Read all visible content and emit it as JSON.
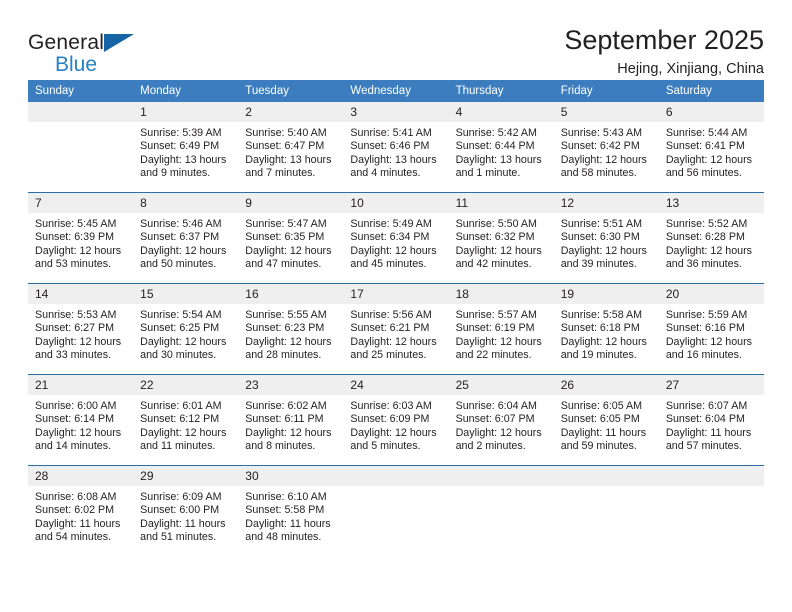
{
  "brand": {
    "name_top": "General",
    "name_bottom": "Blue",
    "accent_color": "#2581c4",
    "triangle_color": "#1565a6"
  },
  "header": {
    "title": "September 2025",
    "subtitle": "Hejing, Xinjiang, China"
  },
  "calendar": {
    "header_bg": "#3b7dbf",
    "header_text_color": "#ffffff",
    "row_divider_color": "#2e6da4",
    "daynum_bg": "#efeff0",
    "weekday_headers": [
      "Sunday",
      "Monday",
      "Tuesday",
      "Wednesday",
      "Thursday",
      "Friday",
      "Saturday"
    ],
    "weeks": [
      [
        {
          "day": "",
          "sunrise": "",
          "sunset": "",
          "daylight_line1": "",
          "daylight_line2": "",
          "empty": true
        },
        {
          "day": "1",
          "sunrise": "Sunrise: 5:39 AM",
          "sunset": "Sunset: 6:49 PM",
          "daylight_line1": "Daylight: 13 hours",
          "daylight_line2": "and 9 minutes."
        },
        {
          "day": "2",
          "sunrise": "Sunrise: 5:40 AM",
          "sunset": "Sunset: 6:47 PM",
          "daylight_line1": "Daylight: 13 hours",
          "daylight_line2": "and 7 minutes."
        },
        {
          "day": "3",
          "sunrise": "Sunrise: 5:41 AM",
          "sunset": "Sunset: 6:46 PM",
          "daylight_line1": "Daylight: 13 hours",
          "daylight_line2": "and 4 minutes."
        },
        {
          "day": "4",
          "sunrise": "Sunrise: 5:42 AM",
          "sunset": "Sunset: 6:44 PM",
          "daylight_line1": "Daylight: 13 hours",
          "daylight_line2": "and 1 minute."
        },
        {
          "day": "5",
          "sunrise": "Sunrise: 5:43 AM",
          "sunset": "Sunset: 6:42 PM",
          "daylight_line1": "Daylight: 12 hours",
          "daylight_line2": "and 58 minutes."
        },
        {
          "day": "6",
          "sunrise": "Sunrise: 5:44 AM",
          "sunset": "Sunset: 6:41 PM",
          "daylight_line1": "Daylight: 12 hours",
          "daylight_line2": "and 56 minutes."
        }
      ],
      [
        {
          "day": "7",
          "sunrise": "Sunrise: 5:45 AM",
          "sunset": "Sunset: 6:39 PM",
          "daylight_line1": "Daylight: 12 hours",
          "daylight_line2": "and 53 minutes."
        },
        {
          "day": "8",
          "sunrise": "Sunrise: 5:46 AM",
          "sunset": "Sunset: 6:37 PM",
          "daylight_line1": "Daylight: 12 hours",
          "daylight_line2": "and 50 minutes."
        },
        {
          "day": "9",
          "sunrise": "Sunrise: 5:47 AM",
          "sunset": "Sunset: 6:35 PM",
          "daylight_line1": "Daylight: 12 hours",
          "daylight_line2": "and 47 minutes."
        },
        {
          "day": "10",
          "sunrise": "Sunrise: 5:49 AM",
          "sunset": "Sunset: 6:34 PM",
          "daylight_line1": "Daylight: 12 hours",
          "daylight_line2": "and 45 minutes."
        },
        {
          "day": "11",
          "sunrise": "Sunrise: 5:50 AM",
          "sunset": "Sunset: 6:32 PM",
          "daylight_line1": "Daylight: 12 hours",
          "daylight_line2": "and 42 minutes."
        },
        {
          "day": "12",
          "sunrise": "Sunrise: 5:51 AM",
          "sunset": "Sunset: 6:30 PM",
          "daylight_line1": "Daylight: 12 hours",
          "daylight_line2": "and 39 minutes."
        },
        {
          "day": "13",
          "sunrise": "Sunrise: 5:52 AM",
          "sunset": "Sunset: 6:28 PM",
          "daylight_line1": "Daylight: 12 hours",
          "daylight_line2": "and 36 minutes."
        }
      ],
      [
        {
          "day": "14",
          "sunrise": "Sunrise: 5:53 AM",
          "sunset": "Sunset: 6:27 PM",
          "daylight_line1": "Daylight: 12 hours",
          "daylight_line2": "and 33 minutes."
        },
        {
          "day": "15",
          "sunrise": "Sunrise: 5:54 AM",
          "sunset": "Sunset: 6:25 PM",
          "daylight_line1": "Daylight: 12 hours",
          "daylight_line2": "and 30 minutes."
        },
        {
          "day": "16",
          "sunrise": "Sunrise: 5:55 AM",
          "sunset": "Sunset: 6:23 PM",
          "daylight_line1": "Daylight: 12 hours",
          "daylight_line2": "and 28 minutes."
        },
        {
          "day": "17",
          "sunrise": "Sunrise: 5:56 AM",
          "sunset": "Sunset: 6:21 PM",
          "daylight_line1": "Daylight: 12 hours",
          "daylight_line2": "and 25 minutes."
        },
        {
          "day": "18",
          "sunrise": "Sunrise: 5:57 AM",
          "sunset": "Sunset: 6:19 PM",
          "daylight_line1": "Daylight: 12 hours",
          "daylight_line2": "and 22 minutes."
        },
        {
          "day": "19",
          "sunrise": "Sunrise: 5:58 AM",
          "sunset": "Sunset: 6:18 PM",
          "daylight_line1": "Daylight: 12 hours",
          "daylight_line2": "and 19 minutes."
        },
        {
          "day": "20",
          "sunrise": "Sunrise: 5:59 AM",
          "sunset": "Sunset: 6:16 PM",
          "daylight_line1": "Daylight: 12 hours",
          "daylight_line2": "and 16 minutes."
        }
      ],
      [
        {
          "day": "21",
          "sunrise": "Sunrise: 6:00 AM",
          "sunset": "Sunset: 6:14 PM",
          "daylight_line1": "Daylight: 12 hours",
          "daylight_line2": "and 14 minutes."
        },
        {
          "day": "22",
          "sunrise": "Sunrise: 6:01 AM",
          "sunset": "Sunset: 6:12 PM",
          "daylight_line1": "Daylight: 12 hours",
          "daylight_line2": "and 11 minutes."
        },
        {
          "day": "23",
          "sunrise": "Sunrise: 6:02 AM",
          "sunset": "Sunset: 6:11 PM",
          "daylight_line1": "Daylight: 12 hours",
          "daylight_line2": "and 8 minutes."
        },
        {
          "day": "24",
          "sunrise": "Sunrise: 6:03 AM",
          "sunset": "Sunset: 6:09 PM",
          "daylight_line1": "Daylight: 12 hours",
          "daylight_line2": "and 5 minutes."
        },
        {
          "day": "25",
          "sunrise": "Sunrise: 6:04 AM",
          "sunset": "Sunset: 6:07 PM",
          "daylight_line1": "Daylight: 12 hours",
          "daylight_line2": "and 2 minutes."
        },
        {
          "day": "26",
          "sunrise": "Sunrise: 6:05 AM",
          "sunset": "Sunset: 6:05 PM",
          "daylight_line1": "Daylight: 11 hours",
          "daylight_line2": "and 59 minutes."
        },
        {
          "day": "27",
          "sunrise": "Sunrise: 6:07 AM",
          "sunset": "Sunset: 6:04 PM",
          "daylight_line1": "Daylight: 11 hours",
          "daylight_line2": "and 57 minutes."
        }
      ],
      [
        {
          "day": "28",
          "sunrise": "Sunrise: 6:08 AM",
          "sunset": "Sunset: 6:02 PM",
          "daylight_line1": "Daylight: 11 hours",
          "daylight_line2": "and 54 minutes."
        },
        {
          "day": "29",
          "sunrise": "Sunrise: 6:09 AM",
          "sunset": "Sunset: 6:00 PM",
          "daylight_line1": "Daylight: 11 hours",
          "daylight_line2": "and 51 minutes."
        },
        {
          "day": "30",
          "sunrise": "Sunrise: 6:10 AM",
          "sunset": "Sunset: 5:58 PM",
          "daylight_line1": "Daylight: 11 hours",
          "daylight_line2": "and 48 minutes."
        },
        {
          "day": "",
          "sunrise": "",
          "sunset": "",
          "daylight_line1": "",
          "daylight_line2": "",
          "empty": true
        },
        {
          "day": "",
          "sunrise": "",
          "sunset": "",
          "daylight_line1": "",
          "daylight_line2": "",
          "empty": true
        },
        {
          "day": "",
          "sunrise": "",
          "sunset": "",
          "daylight_line1": "",
          "daylight_line2": "",
          "empty": true
        },
        {
          "day": "",
          "sunrise": "",
          "sunset": "",
          "daylight_line1": "",
          "daylight_line2": "",
          "empty": true
        }
      ]
    ]
  }
}
